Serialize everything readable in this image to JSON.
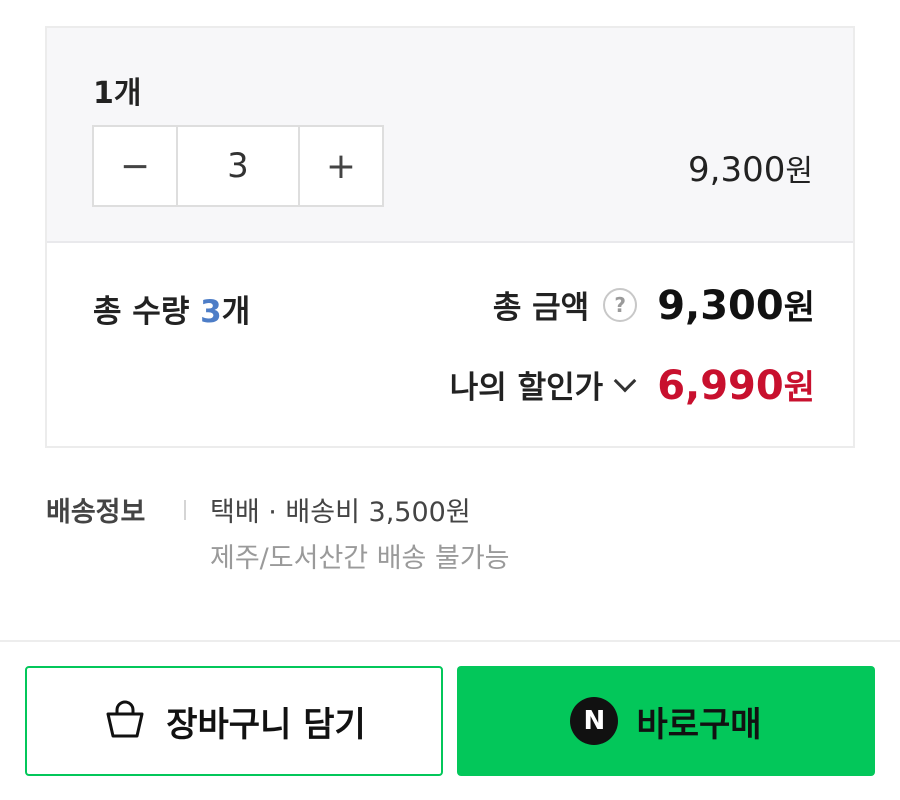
{
  "option": {
    "name": "1개",
    "quantity": "3",
    "minus_symbol": "−",
    "plus_symbol": "+",
    "price": "9,300",
    "price_unit": "원"
  },
  "summary": {
    "total_qty_label": "총 수량",
    "total_qty_value": "3",
    "total_qty_unit": "개",
    "total_amount_label": "총 금액",
    "help_symbol": "?",
    "total_amount": "9,300",
    "total_amount_unit": "원",
    "discount_label": "나의 할인가",
    "discount_amount": "6,990",
    "discount_unit": "원"
  },
  "shipping": {
    "label": "배송정보",
    "main": "택배 · 배송비 3,500원",
    "note": "제주/도서산간 배송 불가능"
  },
  "actions": {
    "cart_label": "장바구니 담기",
    "buy_label": "바로구매",
    "buy_icon_letter": "N"
  },
  "colors": {
    "accent_green": "#03c75a",
    "discount_red": "#c8102e",
    "qty_blue": "#4d7dc7"
  },
  "icons": {
    "cart": "shopping-bag-icon",
    "buy": "naver-n-icon",
    "help": "question-circle-icon",
    "expand": "chevron-down-icon"
  }
}
